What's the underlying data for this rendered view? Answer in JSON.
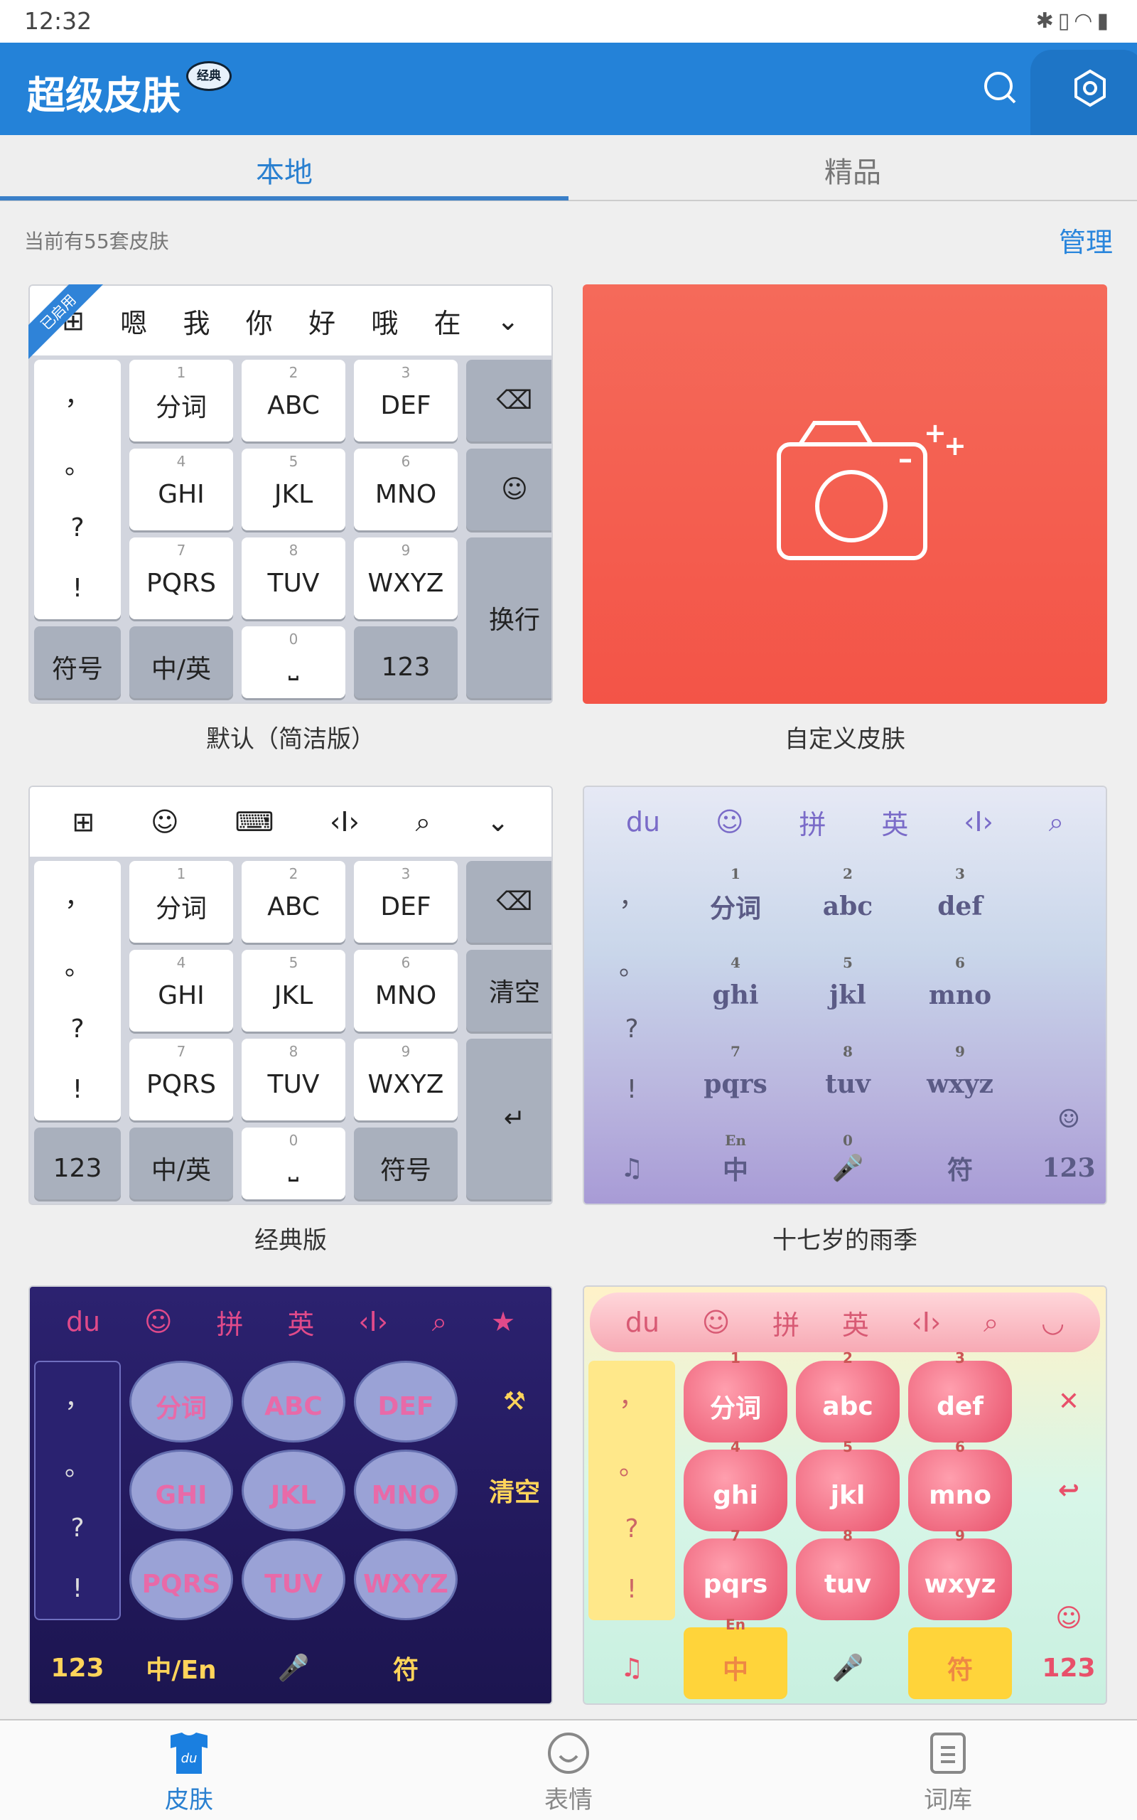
{
  "status_bar": {
    "time": "12:32",
    "icons": [
      "bluetooth-icon",
      "vibrate-icon",
      "wifi-icon",
      "battery-icon"
    ]
  },
  "header": {
    "title": "超级皮肤",
    "badge": "经典",
    "search_icon": "search-icon",
    "settings_icon": "gear-icon"
  },
  "tabs": [
    {
      "label": "本地",
      "active": true
    },
    {
      "label": "精品",
      "active": false
    }
  ],
  "summary": {
    "count_text": "当前有55套皮肤",
    "manage_label": "管理"
  },
  "colors": {
    "primary": "#2482d8",
    "camera_card": "#f35447"
  },
  "skins": [
    {
      "name": "默认（简洁版）",
      "enabled_tag": "已启用",
      "theme": "plain",
      "toolbar": [
        "⊞",
        "嗯",
        "我",
        "你",
        "好",
        "哦",
        "在",
        "⌄"
      ],
      "left": [
        "，",
        "。",
        "?",
        "!"
      ],
      "keys": [
        {
          "num": "1",
          "label": "分词"
        },
        {
          "num": "2",
          "label": "ABC"
        },
        {
          "num": "3",
          "label": "DEF"
        },
        {
          "num": "4",
          "label": "GHI"
        },
        {
          "num": "5",
          "label": "JKL"
        },
        {
          "num": "6",
          "label": "MNO"
        },
        {
          "num": "7",
          "label": "PQRS"
        },
        {
          "num": "8",
          "label": "TUV"
        },
        {
          "num": "9",
          "label": "WXYZ"
        }
      ],
      "right": [
        "⌫",
        "☺",
        "换行"
      ],
      "bottom": [
        {
          "label": "符号"
        },
        {
          "label": "中/英"
        },
        {
          "num": "0",
          "label": "⎵"
        },
        {
          "label": "123"
        }
      ]
    },
    {
      "name": "自定义皮肤",
      "theme": "camera",
      "icon": "camera-plus-icon"
    },
    {
      "name": "经典版",
      "theme": "plain",
      "toolbar": [
        "⊞",
        "☺",
        "⌨",
        "‹I›",
        "⌕",
        "⌄"
      ],
      "left": [
        "，",
        "。",
        "?",
        "!"
      ],
      "keys": [
        {
          "num": "1",
          "label": "分词"
        },
        {
          "num": "2",
          "label": "ABC"
        },
        {
          "num": "3",
          "label": "DEF"
        },
        {
          "num": "4",
          "label": "GHI"
        },
        {
          "num": "5",
          "label": "JKL"
        },
        {
          "num": "6",
          "label": "MNO"
        },
        {
          "num": "7",
          "label": "PQRS"
        },
        {
          "num": "8",
          "label": "TUV"
        },
        {
          "num": "9",
          "label": "WXYZ"
        }
      ],
      "right": [
        "⌫",
        "清空",
        "↵"
      ],
      "bottom": [
        {
          "label": "123"
        },
        {
          "label": "中/英"
        },
        {
          "num": "0",
          "label": "⎵"
        },
        {
          "label": "符号"
        }
      ]
    },
    {
      "name": "十七岁的雨季",
      "theme": "rain",
      "toolbar": [
        "du",
        "☺",
        "拼",
        "英",
        "‹I›",
        "⌕"
      ],
      "left": [
        "，",
        "。",
        "?",
        "!"
      ],
      "keys": [
        {
          "num": "1",
          "label": "分词"
        },
        {
          "num": "2",
          "label": "abc"
        },
        {
          "num": "3",
          "label": "def"
        },
        {
          "num": "4",
          "label": "ghi"
        },
        {
          "num": "5",
          "label": "jkl"
        },
        {
          "num": "6",
          "label": "mno"
        },
        {
          "num": "7",
          "label": "pqrs"
        },
        {
          "num": "8",
          "label": "tuv"
        },
        {
          "num": "9",
          "label": "wxyz"
        }
      ],
      "right": [
        "",
        "",
        "☺"
      ],
      "bottom": [
        {
          "label": "♫"
        },
        {
          "num": "En",
          "label": "中"
        },
        {
          "num": "0",
          "label": "🎤"
        },
        {
          "label": "符"
        },
        {
          "label": "123"
        }
      ]
    },
    {
      "name": "",
      "theme": "night",
      "toolbar": [
        "du",
        "☺",
        "拼",
        "英",
        "‹I›",
        "⌕",
        "★"
      ],
      "left": [
        "，",
        "。",
        "?",
        "!"
      ],
      "keys": [
        {
          "label": "分词"
        },
        {
          "label": "ABC"
        },
        {
          "label": "DEF"
        },
        {
          "label": "GHI"
        },
        {
          "label": "JKL"
        },
        {
          "label": "MNO"
        },
        {
          "label": "PQRS"
        },
        {
          "label": "TUV"
        },
        {
          "label": "WXYZ"
        }
      ],
      "right": [
        "⚒",
        "清空",
        ""
      ],
      "bottom": [
        {
          "label": "123"
        },
        {
          "label": "中/En"
        },
        {
          "label": "🎤"
        },
        {
          "label": "符"
        }
      ]
    },
    {
      "name": "",
      "theme": "pink",
      "toolbar": [
        "du",
        "☺",
        "拼",
        "英",
        "‹I›",
        "⌕",
        "◡"
      ],
      "left": [
        "，",
        "。",
        "?",
        "!"
      ],
      "keys": [
        {
          "num": "1",
          "label": "分词"
        },
        {
          "num": "2",
          "label": "abc"
        },
        {
          "num": "3",
          "label": "def"
        },
        {
          "num": "4",
          "label": "ghi"
        },
        {
          "num": "5",
          "label": "jkl"
        },
        {
          "num": "6",
          "label": "mno"
        },
        {
          "num": "7",
          "label": "pqrs"
        },
        {
          "num": "8",
          "label": "tuv"
        },
        {
          "num": "9",
          "label": "wxyz"
        }
      ],
      "right": [
        "✕",
        "↩",
        "☺"
      ],
      "bottom": [
        {
          "label": "♫"
        },
        {
          "num": "En",
          "label": "中"
        },
        {
          "label": "🎤"
        },
        {
          "label": "符"
        },
        {
          "label": "123"
        }
      ]
    }
  ],
  "bottom_nav": [
    {
      "label": "皮肤",
      "icon": "tshirt-icon",
      "active": true
    },
    {
      "label": "表情",
      "icon": "smiley-icon",
      "active": false
    },
    {
      "label": "词库",
      "icon": "dictionary-icon",
      "active": false
    }
  ]
}
